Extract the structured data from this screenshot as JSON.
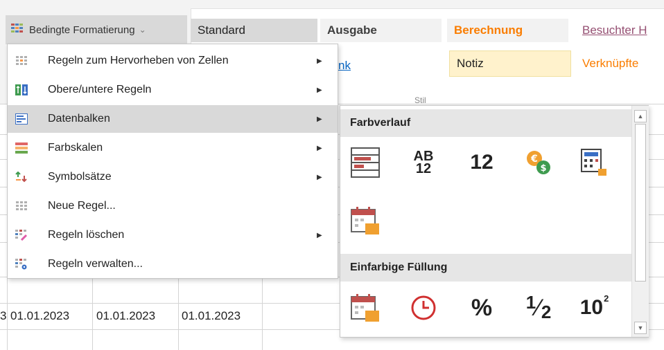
{
  "ribbon": {
    "cf_button_label": "Bedingte Formatierung",
    "styles": {
      "standard": "Standard",
      "ausgabe": "Ausgabe",
      "berechnung": "Berechnung",
      "besucht": "Besuchter H",
      "link": "nk",
      "notiz": "Notiz",
      "verknuepft": "Verknüpfte"
    },
    "group_label": "Stil"
  },
  "menu": {
    "items": [
      {
        "label": "Regeln zum Hervorheben von Zellen",
        "icon": "highlight-cells-icon",
        "submenu": true
      },
      {
        "label": "Obere/untere Regeln",
        "icon": "top-bottom-icon",
        "submenu": true
      },
      {
        "label": "Datenbalken",
        "icon": "data-bars-icon",
        "submenu": true,
        "active": true
      },
      {
        "label": "Farbskalen",
        "icon": "color-scales-icon",
        "submenu": true
      },
      {
        "label": "Symbolsätze",
        "icon": "icon-sets-icon",
        "submenu": true
      },
      {
        "label": "Neue Regel...",
        "icon": "new-rule-icon",
        "submenu": false
      },
      {
        "label": "Regeln löschen",
        "icon": "clear-rules-icon",
        "submenu": true
      },
      {
        "label": "Regeln verwalten...",
        "icon": "manage-rules-icon",
        "submenu": false
      }
    ]
  },
  "submenu": {
    "gradient_header": "Farbverlauf",
    "solid_header": "Einfarbige Füllung",
    "gradient_icons": [
      "data-bar-icon",
      "text-ab12-icon",
      "number-12-icon",
      "currency-icon",
      "calculator-icon",
      "calendar-icon"
    ],
    "solid_icons": [
      "calendar-icon",
      "clock-icon",
      "percent-icon",
      "fraction-icon",
      "scientific-icon"
    ],
    "labels": {
      "ab_top": "AB",
      "ab_bottom": "12",
      "twelve": "12",
      "percent": "%",
      "half_num": "1",
      "half_den": "2",
      "ten": "10",
      "exp": "2"
    }
  },
  "grid": {
    "dates": [
      "01.01.2023",
      "01.01.2023",
      "01.01.2023"
    ],
    "left_fragment": "3"
  },
  "colors": {
    "menu_active": "#d9d9d9",
    "orange": "#fa7d00",
    "notiz_bg": "#fff2cc"
  }
}
